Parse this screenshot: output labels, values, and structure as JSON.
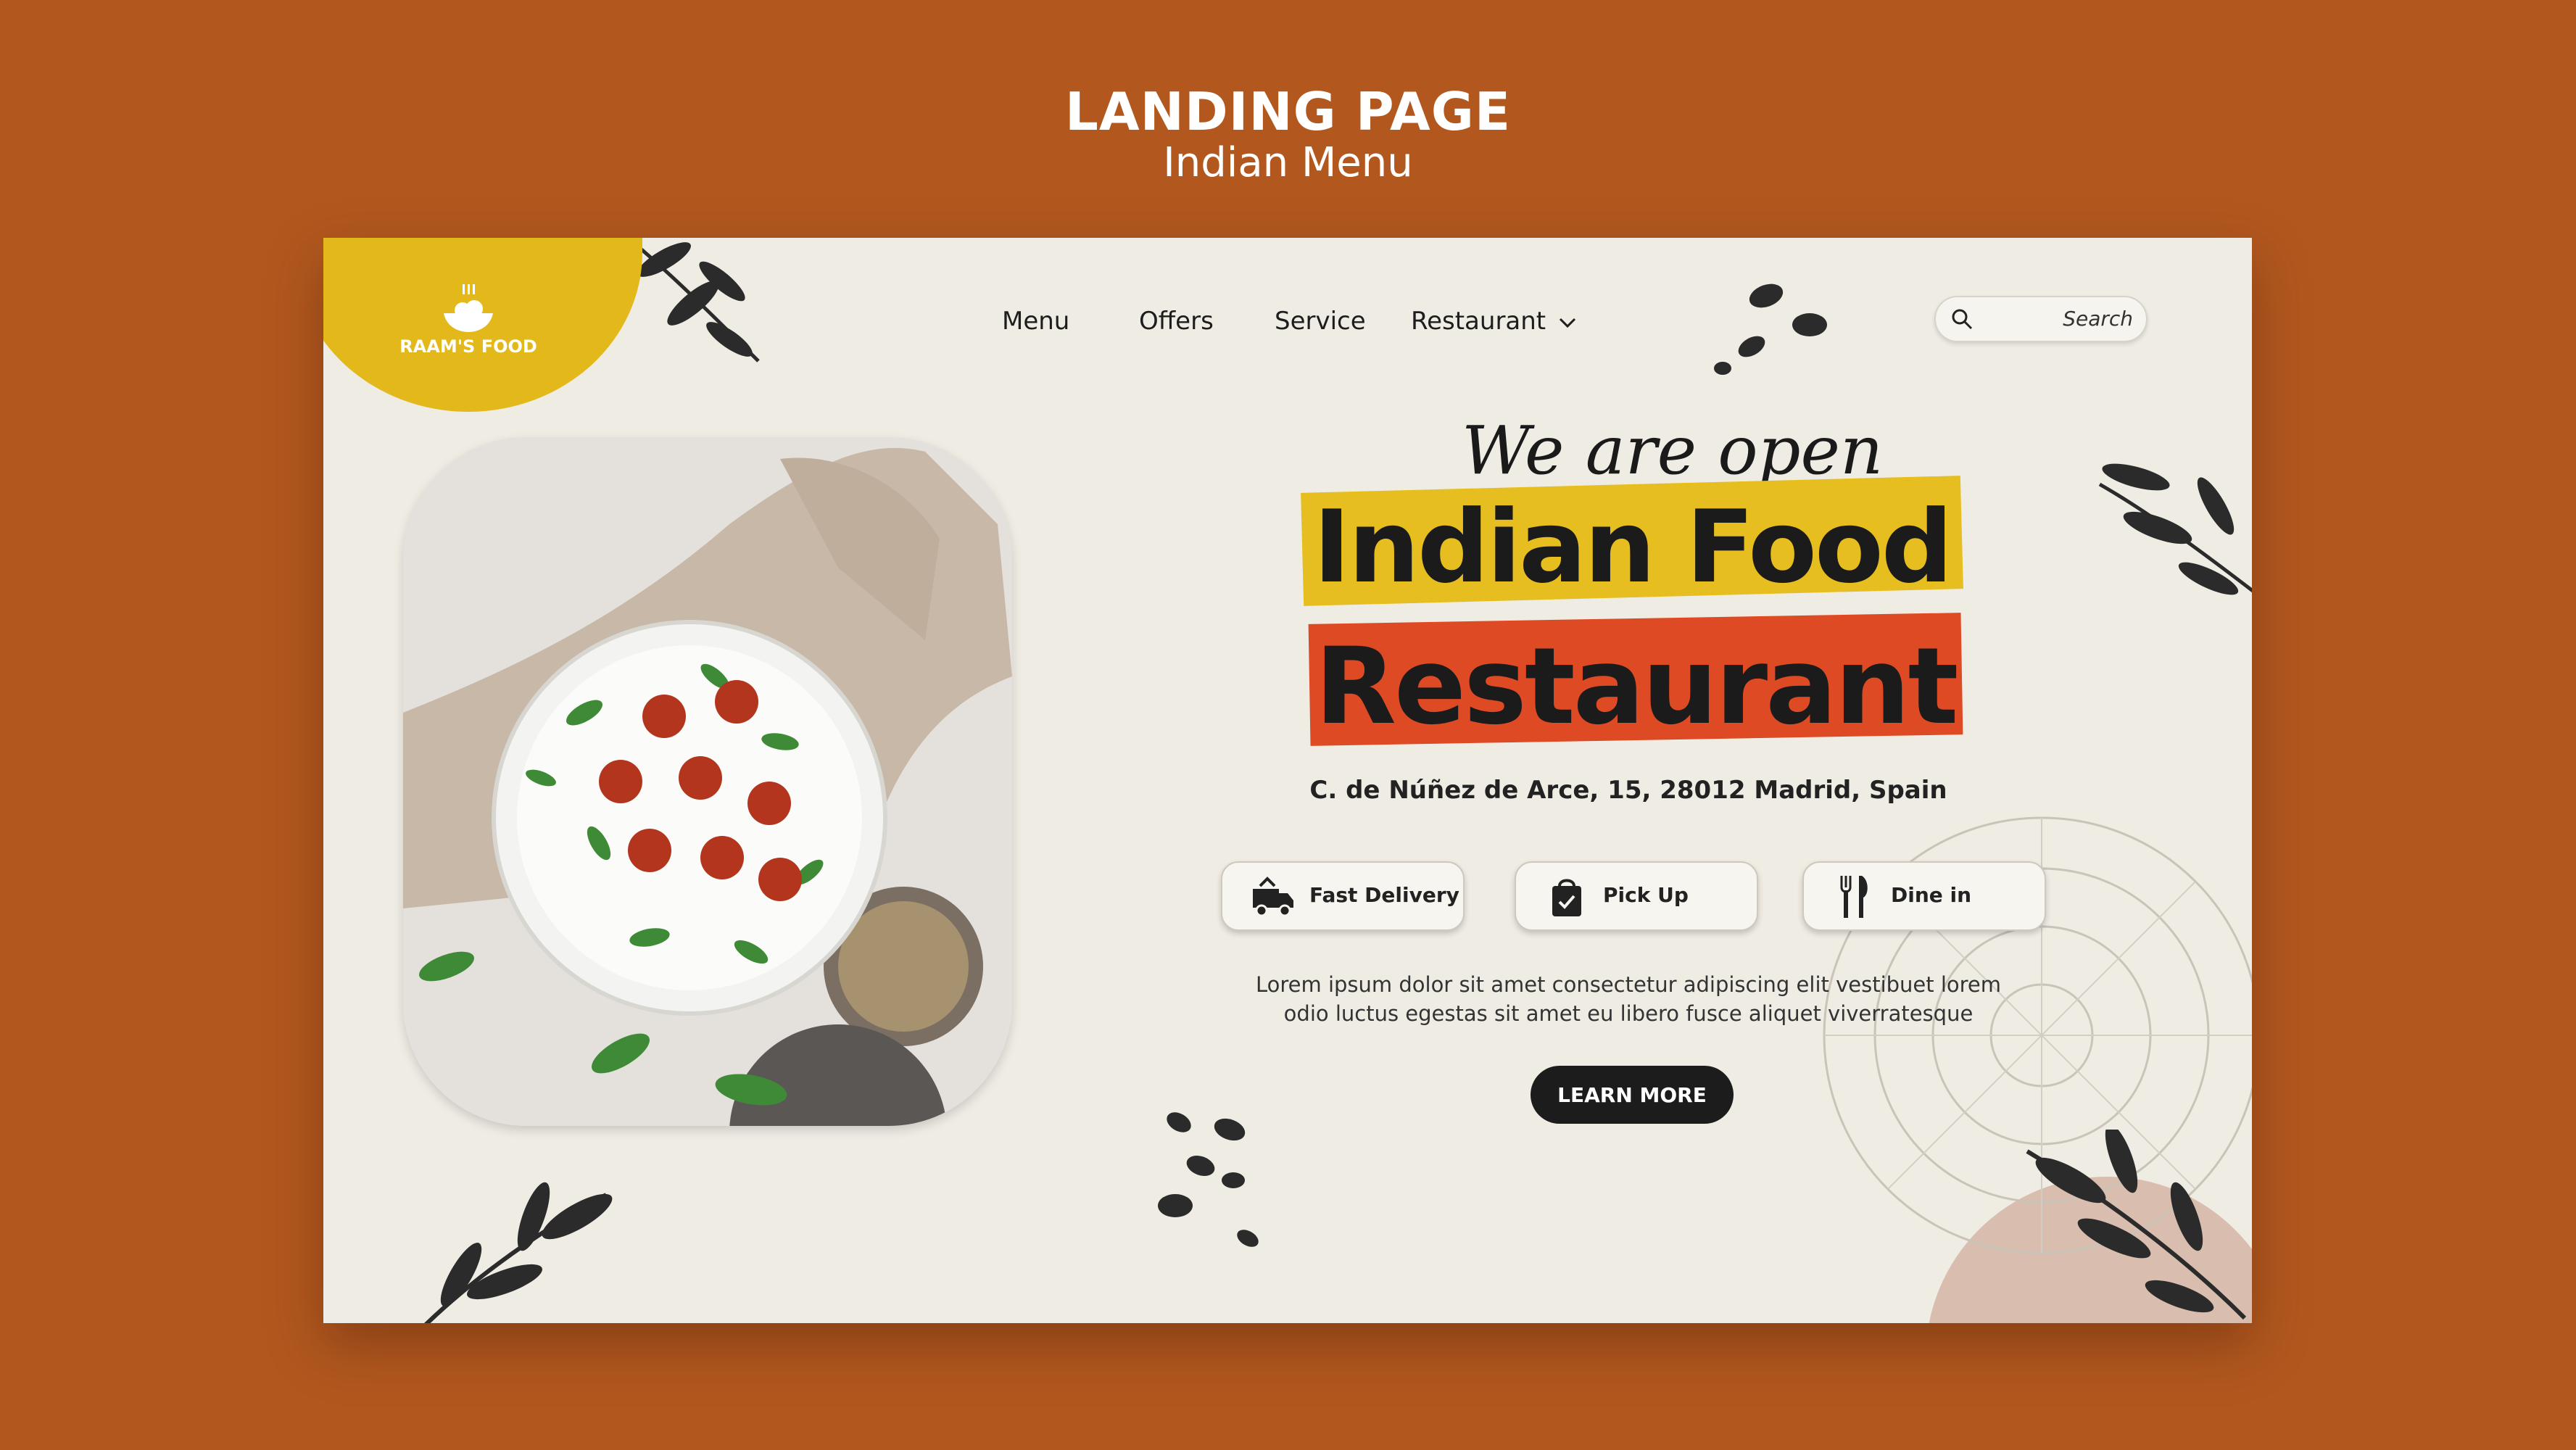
{
  "frame": {
    "title": "LANDING PAGE",
    "subtitle": "Indian Menu"
  },
  "brand": {
    "name": "RAAM'S FOOD",
    "logo_icon": "food-bowl-icon"
  },
  "nav": {
    "items": [
      {
        "label": "Menu"
      },
      {
        "label": "Offers"
      },
      {
        "label": "Service"
      },
      {
        "label": "Restaurant"
      }
    ]
  },
  "search": {
    "placeholder": "Search",
    "icon": "search-icon"
  },
  "hero": {
    "tagline": "We are open",
    "headline_line1": "Indian Food",
    "headline_line2": "Restaurant",
    "address": "C. de Núñez de Arce, 15, 28012 Madrid, Spain",
    "description_line1": "Lorem ipsum dolor sit amet consectetur adipiscing elit vestibuet lorem",
    "description_line2": "odio luctus egestas sit amet eu libero fusce aliquet viverratesque",
    "cta_label": "LEARN MORE"
  },
  "services": [
    {
      "label": "Fast Delivery",
      "icon": "delivery-truck-icon"
    },
    {
      "label": "Pick Up",
      "icon": "shopping-bag-icon"
    },
    {
      "label": "Dine in",
      "icon": "fork-knife-icon"
    }
  ],
  "colors": {
    "background": "#B2581F",
    "card": "#EFECE4",
    "accent_yellow": "#E7BE1F",
    "accent_red": "#DE4A24",
    "dark": "#1C1C1C"
  }
}
